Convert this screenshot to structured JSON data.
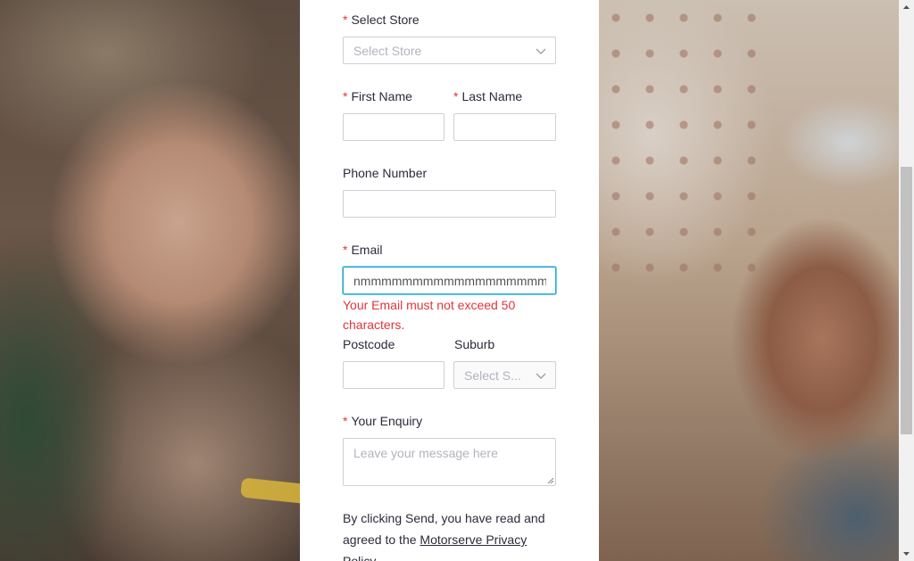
{
  "form": {
    "store": {
      "label": "Select Store",
      "placeholder": "Select Store"
    },
    "first_name": {
      "label": "First Name"
    },
    "last_name": {
      "label": "Last Name"
    },
    "phone": {
      "label": "Phone Number"
    },
    "email": {
      "label": "Email",
      "value": "nmmmmmmmmmmmmmmmmmmmmmmmmmmmmmmm",
      "error": "Your Email must not exceed 50 characters."
    },
    "postcode": {
      "label": "Postcode"
    },
    "suburb": {
      "label": "Suburb",
      "placeholder": "Select S..."
    },
    "enquiry": {
      "label": "Your Enquiry",
      "placeholder": "Leave your message here"
    },
    "required_marker": "*",
    "legal": {
      "prefix": "By clicking Send, you have read and agreed to the ",
      "link": "Motorserve Privacy Policy"
    }
  },
  "colors": {
    "required": "#e0353b",
    "error": "#e0353b",
    "focus_border": "#2aa7c9",
    "text": "#2b2b3c"
  },
  "icons": {
    "select_store_chevron": "chevron-down-icon",
    "suburb_chevron": "chevron-down-icon",
    "scroll_up": "arrow-up-icon",
    "scroll_down": "arrow-down-icon"
  }
}
